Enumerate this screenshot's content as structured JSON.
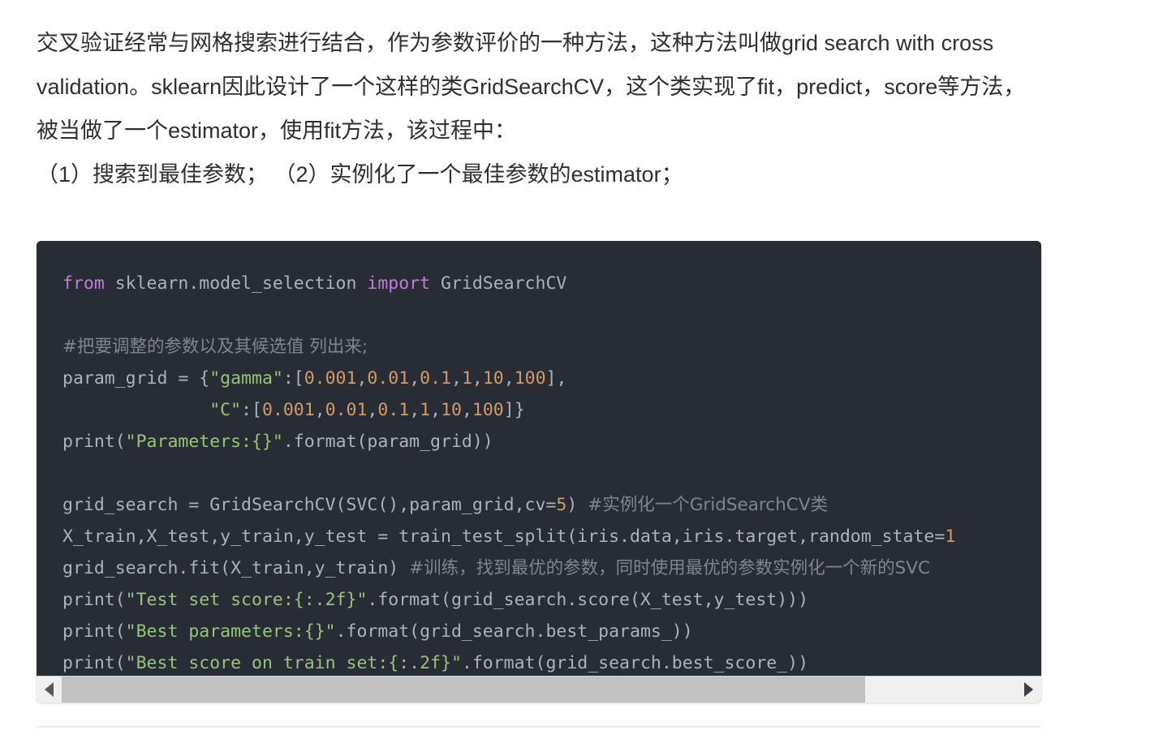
{
  "page": {
    "background_color": "#ffffff",
    "text_color": "#2f2f2f"
  },
  "article": {
    "paragraph_1": "交叉验证经常与网格搜索进行结合，作为参数评价的一种方法，这种方法叫做grid search with cross validation。sklearn因此设计了一个这样的类GridSearchCV，这个类实现了fit，predict，score等方法，被当做了一个estimator，使用fit方法，该过程中：",
    "paragraph_2": "（1）搜索到最佳参数； （2）实例化了一个最佳参数的estimator；"
  },
  "code_block": {
    "background_color": "#282c34",
    "language": "python",
    "colors": {
      "keyword": "#c678dd",
      "string": "#98c379",
      "number": "#d19a66",
      "comment": "#7f848e",
      "plain": "#abb2bf"
    },
    "lines": [
      {
        "index": 1,
        "tokens": [
          {
            "t": "from",
            "k": "kw"
          },
          {
            "t": " sklearn.model_selection ",
            "k": "plain"
          },
          {
            "t": "import",
            "k": "kw"
          },
          {
            "t": " GridSearchCV",
            "k": "plain"
          }
        ]
      },
      {
        "index": 2,
        "tokens": []
      },
      {
        "index": 3,
        "tokens": [
          {
            "t": "#把要调整的参数以及其候选值 列出来;",
            "k": "cmt"
          }
        ]
      },
      {
        "index": 4,
        "tokens": [
          {
            "t": "param_grid = {",
            "k": "plain"
          },
          {
            "t": "\"gamma\"",
            "k": "str"
          },
          {
            "t": ":[",
            "k": "plain"
          },
          {
            "t": "0.001",
            "k": "num"
          },
          {
            "t": ",",
            "k": "plain"
          },
          {
            "t": "0.01",
            "k": "num"
          },
          {
            "t": ",",
            "k": "plain"
          },
          {
            "t": "0.1",
            "k": "num"
          },
          {
            "t": ",",
            "k": "plain"
          },
          {
            "t": "1",
            "k": "num"
          },
          {
            "t": ",",
            "k": "plain"
          },
          {
            "t": "10",
            "k": "num"
          },
          {
            "t": ",",
            "k": "plain"
          },
          {
            "t": "100",
            "k": "num"
          },
          {
            "t": "],",
            "k": "plain"
          }
        ]
      },
      {
        "index": 5,
        "tokens": [
          {
            "t": "              ",
            "k": "plain"
          },
          {
            "t": "\"C\"",
            "k": "str"
          },
          {
            "t": ":[",
            "k": "plain"
          },
          {
            "t": "0.001",
            "k": "num"
          },
          {
            "t": ",",
            "k": "plain"
          },
          {
            "t": "0.01",
            "k": "num"
          },
          {
            "t": ",",
            "k": "plain"
          },
          {
            "t": "0.1",
            "k": "num"
          },
          {
            "t": ",",
            "k": "plain"
          },
          {
            "t": "1",
            "k": "num"
          },
          {
            "t": ",",
            "k": "plain"
          },
          {
            "t": "10",
            "k": "num"
          },
          {
            "t": ",",
            "k": "plain"
          },
          {
            "t": "100",
            "k": "num"
          },
          {
            "t": "]}",
            "k": "plain"
          }
        ]
      },
      {
        "index": 6,
        "tokens": [
          {
            "t": "print(",
            "k": "plain"
          },
          {
            "t": "\"Parameters:{}\"",
            "k": "str"
          },
          {
            "t": ".format(param_grid))",
            "k": "plain"
          }
        ]
      },
      {
        "index": 7,
        "tokens": []
      },
      {
        "index": 8,
        "tokens": [
          {
            "t": "grid_search = GridSearchCV(SVC(),param_grid,cv=",
            "k": "plain"
          },
          {
            "t": "5",
            "k": "num"
          },
          {
            "t": ") ",
            "k": "plain"
          },
          {
            "t": "#实例化一个GridSearchCV类",
            "k": "cmt"
          }
        ]
      },
      {
        "index": 9,
        "tokens": [
          {
            "t": "X_train,X_test,y_train,y_test = train_test_split(iris.data,iris.target,random_state=",
            "k": "plain"
          },
          {
            "t": "1",
            "k": "num"
          }
        ]
      },
      {
        "index": 10,
        "tokens": [
          {
            "t": "grid_search.fit(X_train,y_train) ",
            "k": "plain"
          },
          {
            "t": "#训练，找到最优的参数，同时使用最优的参数实例化一个新的SVC",
            "k": "cmt"
          }
        ]
      },
      {
        "index": 11,
        "tokens": [
          {
            "t": "print(",
            "k": "plain"
          },
          {
            "t": "\"Test set score:{:.2f}\"",
            "k": "str"
          },
          {
            "t": ".format(grid_search.score(X_test,y_test)))",
            "k": "plain"
          }
        ]
      },
      {
        "index": 12,
        "tokens": [
          {
            "t": "print(",
            "k": "plain"
          },
          {
            "t": "\"Best parameters:{}\"",
            "k": "str"
          },
          {
            "t": ".format(grid_search.best_params_))",
            "k": "plain"
          }
        ]
      },
      {
        "index": 13,
        "tokens": [
          {
            "t": "print(",
            "k": "plain"
          },
          {
            "t": "\"Best score on train set:{:.2f}\"",
            "k": "str"
          },
          {
            "t": ".format(grid_search.best_score_))",
            "k": "plain"
          }
        ]
      }
    ]
  },
  "scrollbar": {
    "orientation": "horizontal",
    "left_arrow": "◀",
    "right_arrow": "▶",
    "thumb_color": "#c1c1c1",
    "track_color": "#f0f0f0"
  }
}
